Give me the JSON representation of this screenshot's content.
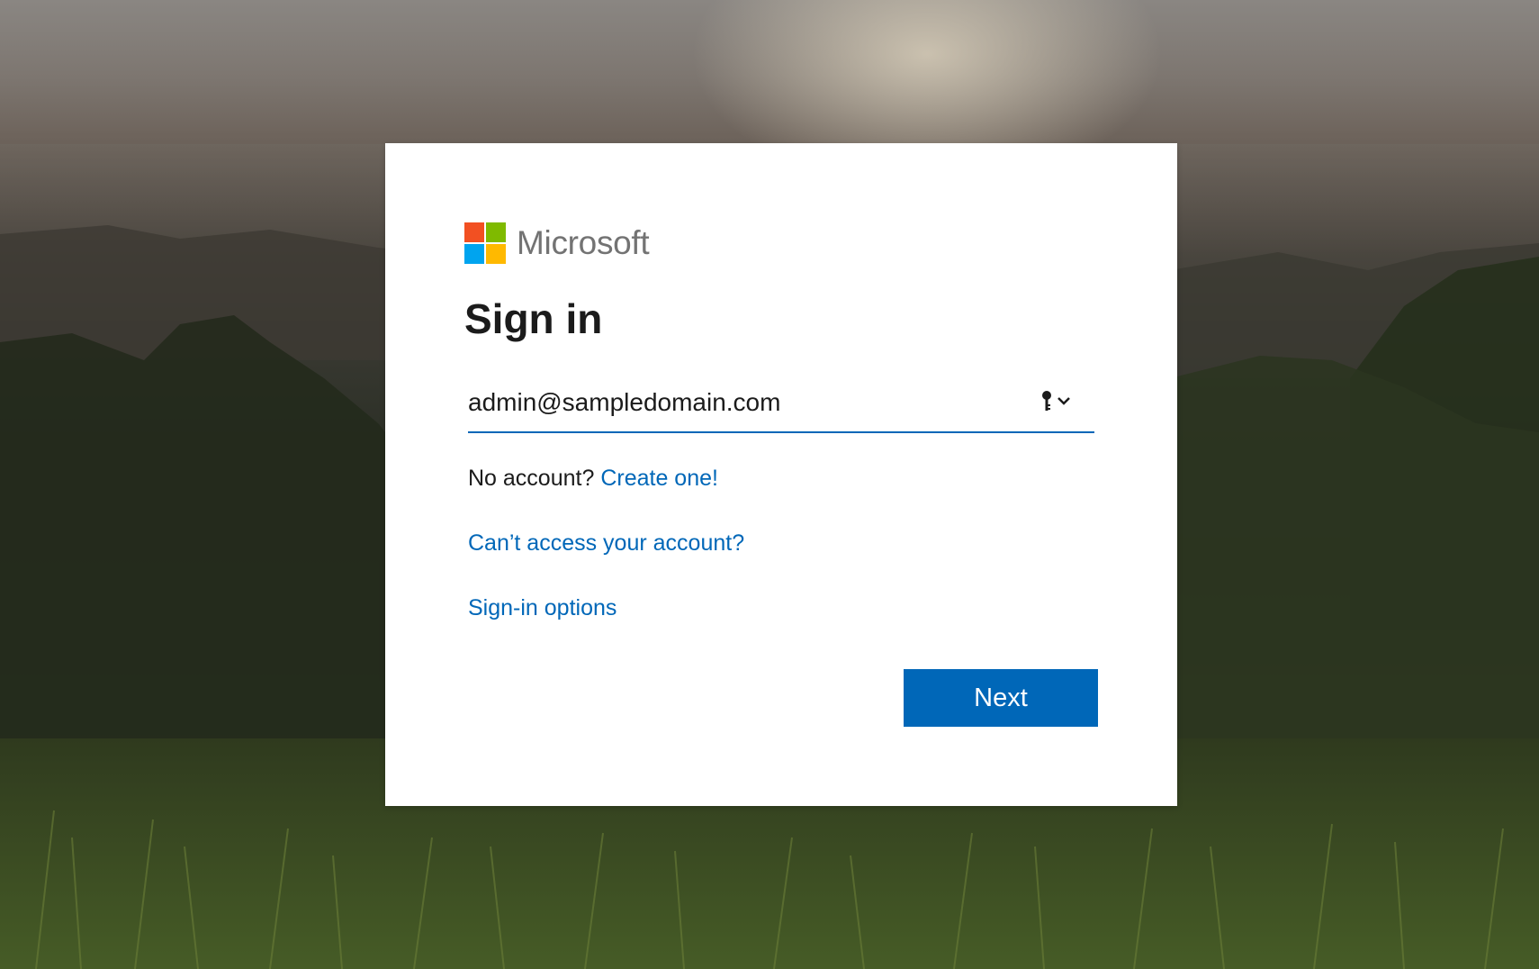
{
  "background": {
    "description_icon": "landscape-background"
  },
  "logo": {
    "text": "Microsoft",
    "colors": [
      "#f25022",
      "#7fba00",
      "#00a4ef",
      "#ffb900"
    ]
  },
  "signin": {
    "title": "Sign in",
    "email_value": "admin@sampledomain.com",
    "password_manager_icon": "key-icon",
    "dropdown_icon": "chevron-down-icon",
    "no_account_text": "No account?",
    "create_link": "Create one!",
    "cant_access_link": "Can’t access your account?",
    "options_link": "Sign-in options",
    "next_label": "Next"
  },
  "colors": {
    "accent": "#0067b8",
    "text": "#1b1b1b"
  }
}
